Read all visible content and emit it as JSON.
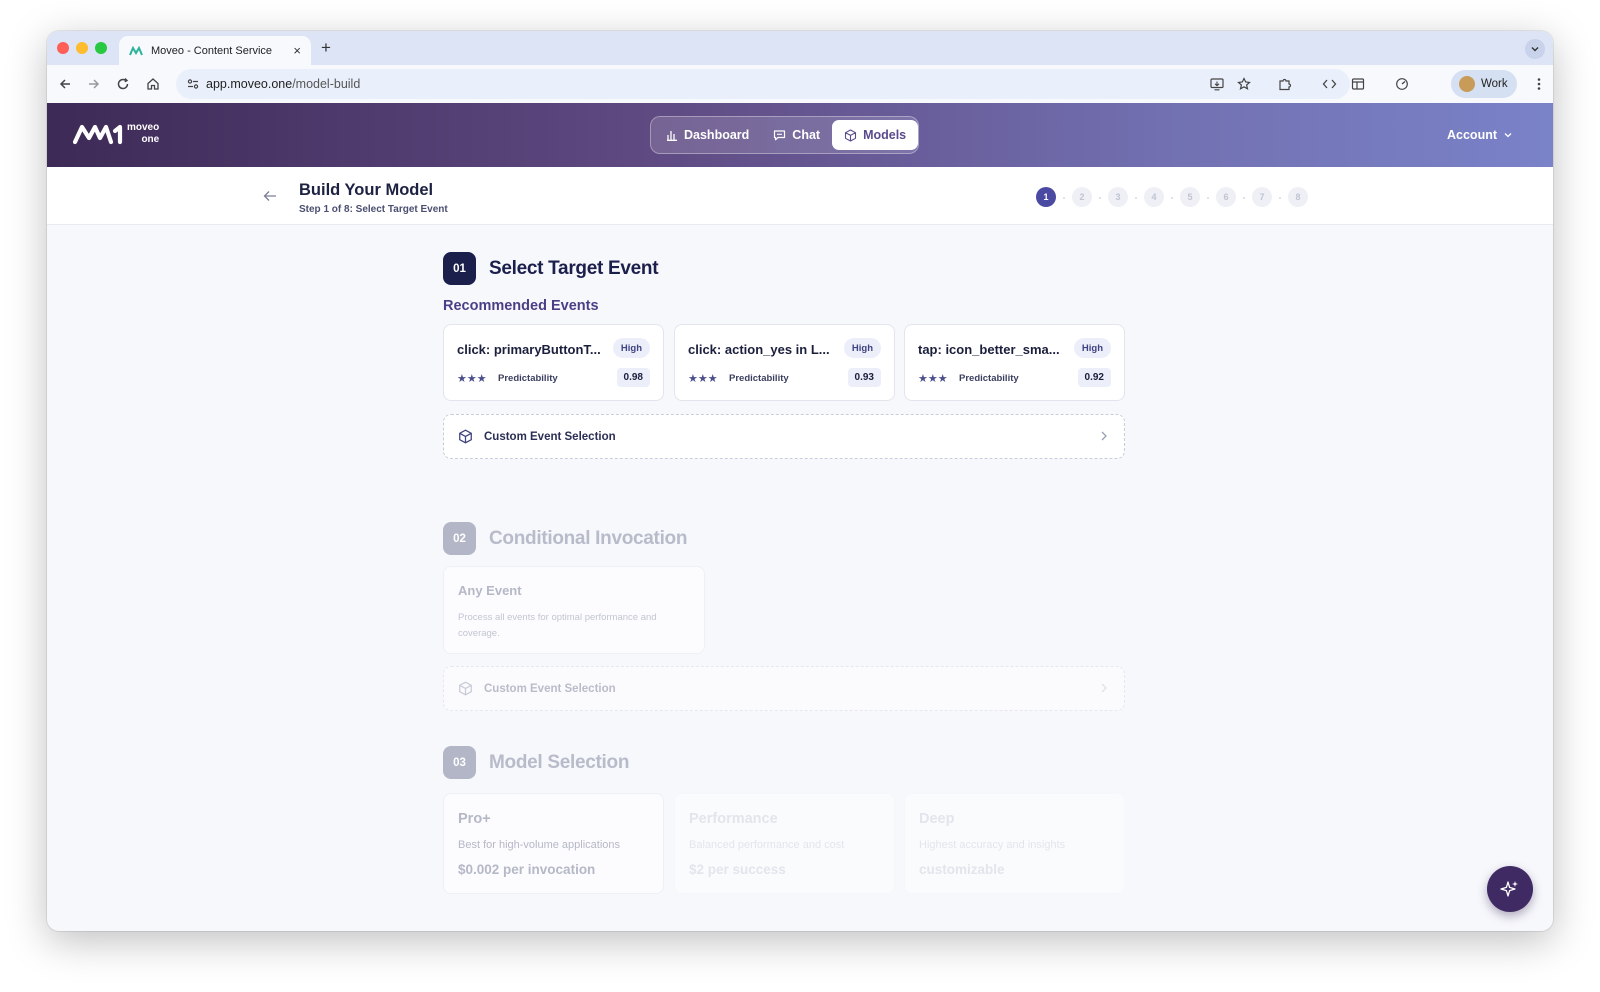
{
  "browser": {
    "tab_title": "Moveo - Content Service",
    "tab_close": "×",
    "new_tab": "+",
    "url_host": "app.moveo.one",
    "url_path": "/model-build",
    "profile_label": "Work"
  },
  "app": {
    "logo_line1": "moveo",
    "logo_line2": "one",
    "nav": [
      {
        "label": "Dashboard",
        "icon": "bar-chart-icon",
        "active": false
      },
      {
        "label": "Chat",
        "icon": "chat-bubble-icon",
        "active": false
      },
      {
        "label": "Models",
        "icon": "cube-icon",
        "active": true
      }
    ],
    "account_label": "Account",
    "brand_gradient": [
      "#3d2a56",
      "#7a82c8"
    ],
    "accent": "#4b4aa3"
  },
  "stepper": {
    "title": "Build Your Model",
    "subtitle": "Step 1 of 8: Select Target Event",
    "steps": [
      "1",
      "2",
      "3",
      "4",
      "5",
      "6",
      "7",
      "8"
    ],
    "current_step": 1
  },
  "sections": {
    "target": {
      "number": "01",
      "title": "Select Target Event",
      "recommended_title": "Recommended Events",
      "events": [
        {
          "name": "click: primaryButtonT...",
          "badge": "High",
          "stars": "★★★",
          "metric_label": "Predictability",
          "score": "0.98"
        },
        {
          "name": "click: action_yes in L...",
          "badge": "High",
          "stars": "★★★",
          "metric_label": "Predictability",
          "score": "0.93"
        },
        {
          "name": "tap: icon_better_sma...",
          "badge": "High",
          "stars": "★★★",
          "metric_label": "Predictability",
          "score": "0.92"
        }
      ],
      "custom_label": "Custom Event Selection"
    },
    "conditional": {
      "number": "02",
      "title": "Conditional Invocation",
      "any_title": "Any Event",
      "any_desc": "Process all events for optimal performance and coverage.",
      "custom_label": "Custom Event Selection"
    },
    "model": {
      "number": "03",
      "title": "Model Selection",
      "models": [
        {
          "name": "Pro+",
          "desc": "Best for high-volume applications",
          "price": "$0.002 per invocation"
        },
        {
          "name": "Performance",
          "desc": "Balanced performance and cost",
          "price": "$2 per success"
        },
        {
          "name": "Deep",
          "desc": "Highest accuracy and insights",
          "price": "customizable"
        }
      ]
    }
  }
}
